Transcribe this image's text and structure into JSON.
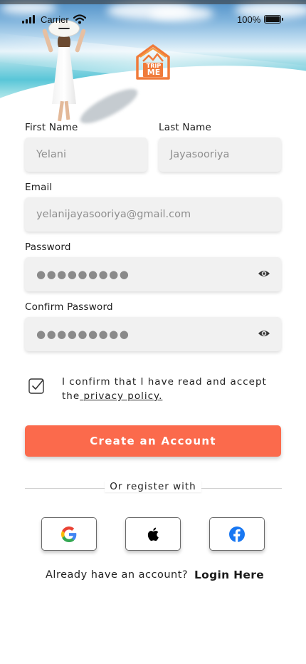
{
  "status_bar": {
    "carrier": "Carrier",
    "battery_percent": "100%"
  },
  "brand": {
    "logo_text_top": "TRIP",
    "logo_text_bottom": "ME",
    "accent_color": "#fb6a4c"
  },
  "form": {
    "first_name": {
      "label": "First Name",
      "value": "Yelani"
    },
    "last_name": {
      "label": "Last Name",
      "value": "Jayasooriya"
    },
    "email": {
      "label": "Email",
      "value": "yelanijayasooriya@gmail.com"
    },
    "password": {
      "label": "Password",
      "value": "●●●●●●●●●",
      "icon": "eye-icon"
    },
    "confirm_password": {
      "label": "Confirm Password",
      "value": "●●●●●●●●●",
      "icon": "eye-icon"
    },
    "consent": {
      "text": "I confirm that I have read and accept the",
      "link": " privacy policy.",
      "checked": true
    },
    "submit_label": "Create an Account"
  },
  "social": {
    "divider_text": "Or register with",
    "providers": [
      "google-icon",
      "apple-icon",
      "facebook-icon"
    ]
  },
  "footer": {
    "prompt": "Already have an account?",
    "login_label": "Login Here"
  }
}
